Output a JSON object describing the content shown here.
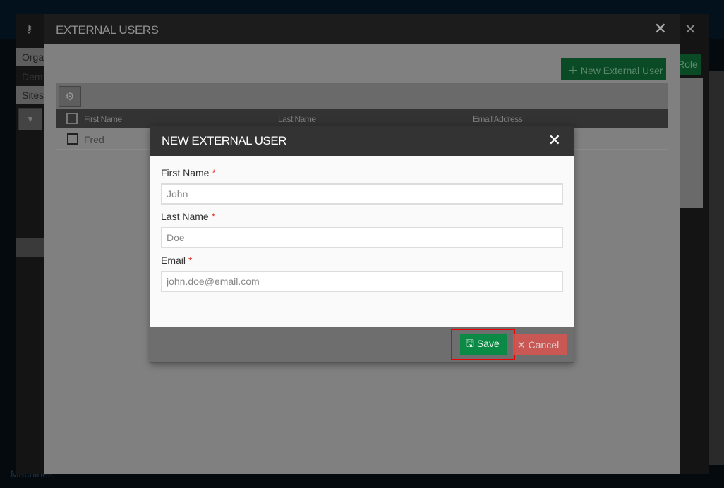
{
  "background": {
    "sidebar_items": [
      "Orga",
      "Dem",
      "Sites"
    ],
    "role_button": "Role",
    "bottom_label": "Machines"
  },
  "external_users": {
    "title": "EXTERNAL USERS",
    "new_button": "New External User",
    "columns": [
      "First Name",
      "Last Name",
      "Email Address"
    ],
    "rows": [
      {
        "first_name": "Fred"
      }
    ]
  },
  "dialog": {
    "title": "NEW EXTERNAL USER",
    "fields": [
      {
        "label": "First Name",
        "placeholder": "John"
      },
      {
        "label": "Last Name",
        "placeholder": "Doe"
      },
      {
        "label": "Email",
        "placeholder": "john.doe@email.com"
      }
    ],
    "required_mark": "*",
    "save_label": "Save",
    "cancel_label": "Cancel"
  }
}
